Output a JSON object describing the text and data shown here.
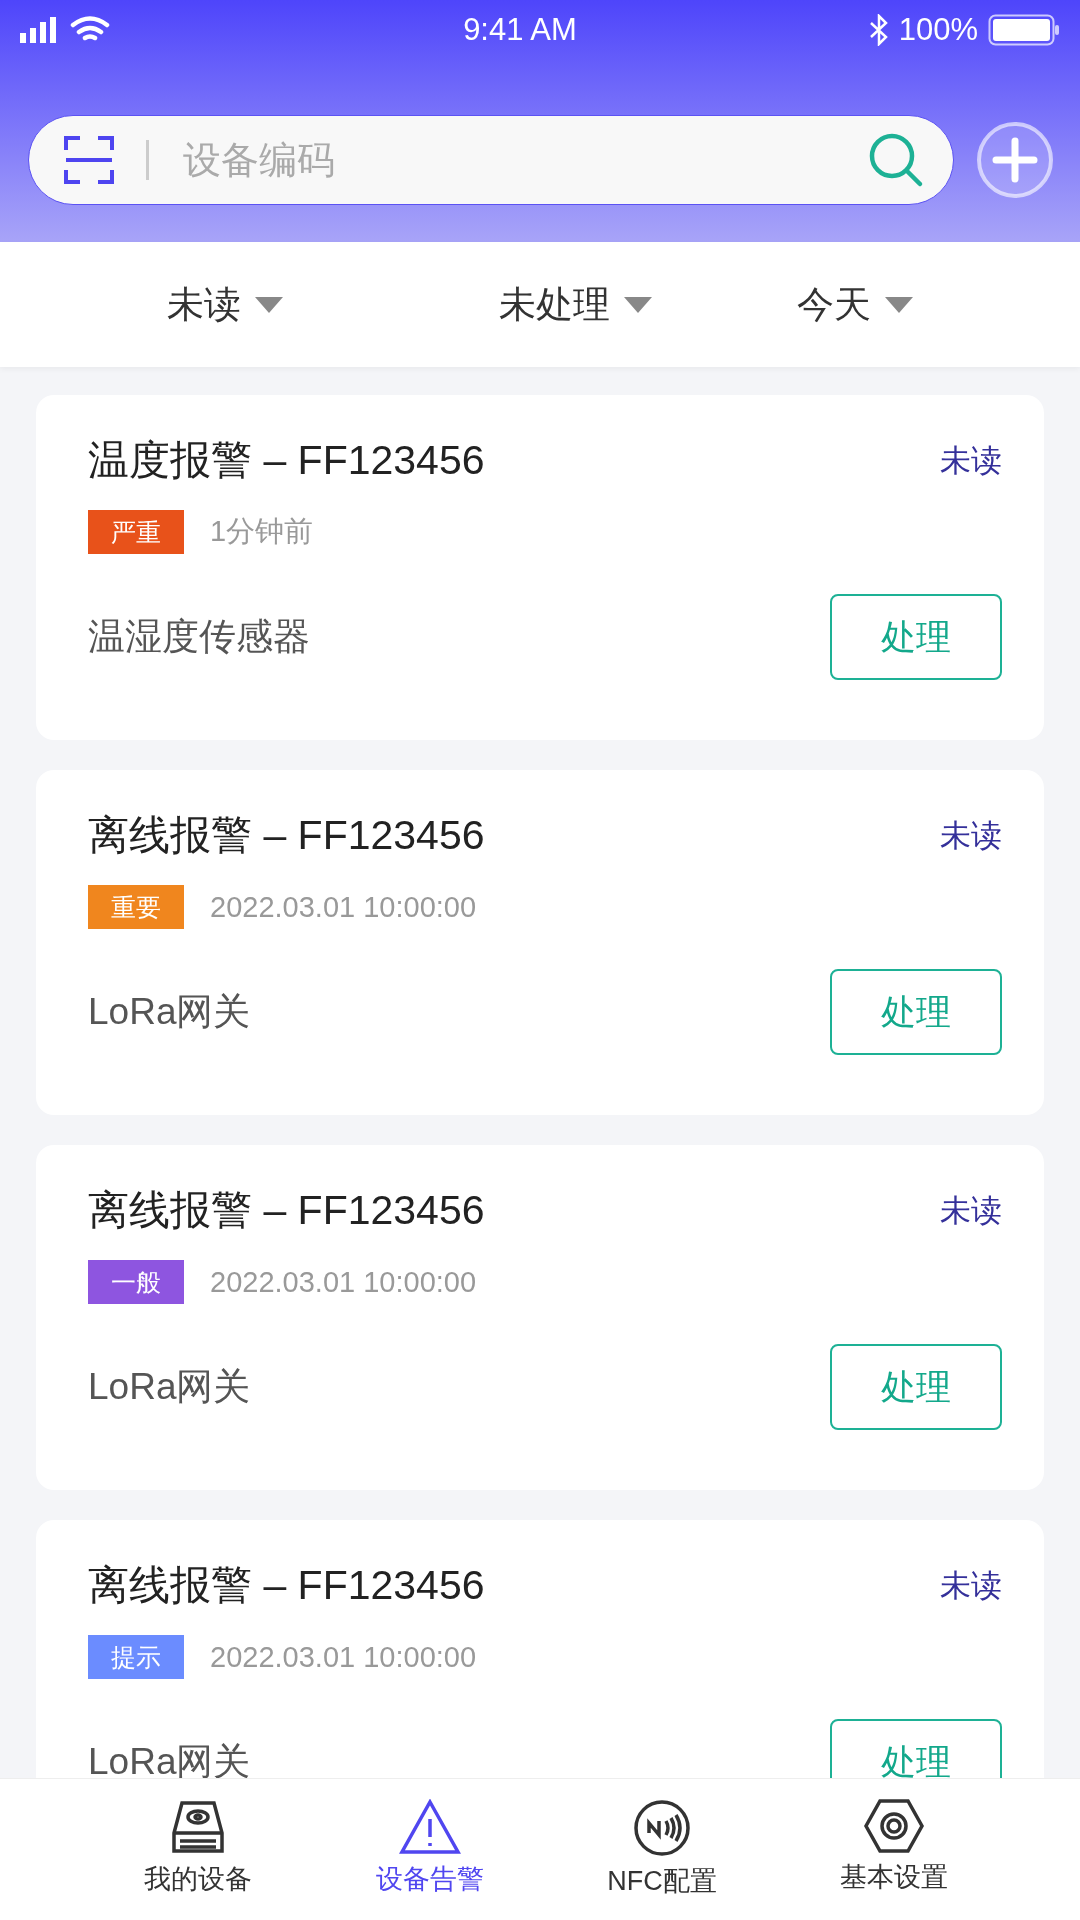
{
  "status_bar": {
    "time": "9:41 AM",
    "battery": "100%"
  },
  "search": {
    "placeholder": "设备编码"
  },
  "filters": [
    {
      "label": "未读"
    },
    {
      "label": "未处理"
    },
    {
      "label": "今天"
    }
  ],
  "alarms": [
    {
      "title": "温度报警 – FF123456",
      "read_state": "未读",
      "severity": "严重",
      "color": "#e8521a",
      "time": "1分钟前",
      "device": "温湿度传感器",
      "action": "处理"
    },
    {
      "title": "离线报警 – FF123456",
      "read_state": "未读",
      "severity": "重要",
      "color": "#f0861e",
      "time": "2022.03.01 10:00:00",
      "device": "LoRa网关",
      "action": "处理"
    },
    {
      "title": "离线报警 – FF123456",
      "read_state": "未读",
      "severity": "一般",
      "color": "#8e55e0",
      "time": "2022.03.01 10:00:00",
      "device": "LoRa网关",
      "action": "处理"
    },
    {
      "title": "离线报警 – FF123456",
      "read_state": "未读",
      "severity": "提示",
      "color": "#6b8cff",
      "time": "2022.03.01 10:00:00",
      "device": "LoRa网关",
      "action": "处理"
    }
  ],
  "tabs": [
    {
      "label": "我的设备",
      "kind": "device",
      "selected": false
    },
    {
      "label": "设备告警",
      "kind": "alarm",
      "selected": true
    },
    {
      "label": "NFC配置",
      "kind": "nfc",
      "selected": false
    },
    {
      "label": "基本设置",
      "kind": "settings",
      "selected": false
    }
  ]
}
